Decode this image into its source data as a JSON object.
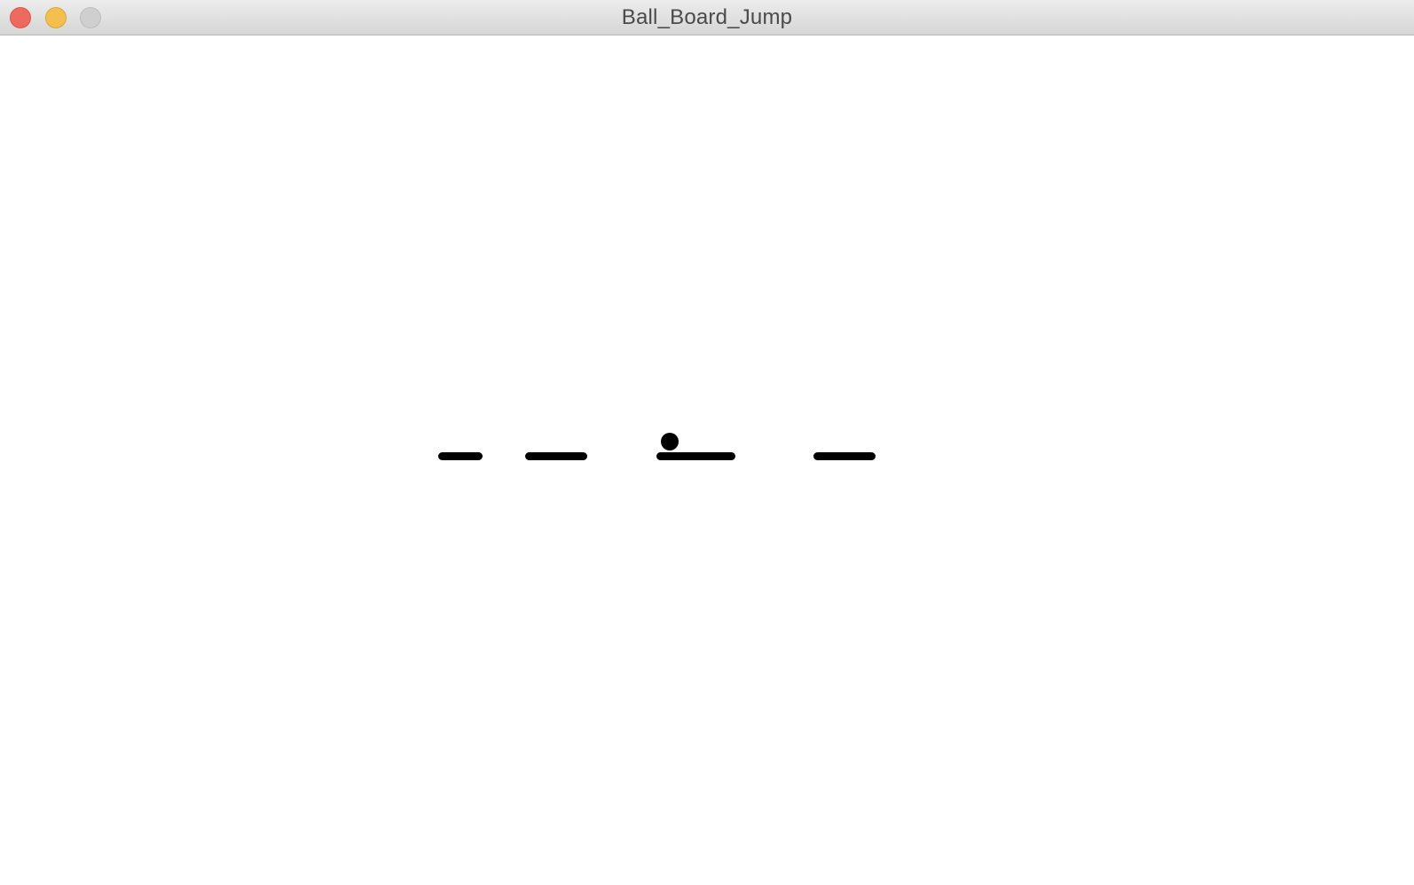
{
  "window": {
    "title": "Ball_Board_Jump",
    "background": "#ffffff",
    "buttons": [
      {
        "name": "close-button",
        "color": "#ee6a5f",
        "border": "#d9554b"
      },
      {
        "name": "minimize-button",
        "color": "#f5bf4f",
        "border": "#dca43b"
      },
      {
        "name": "zoom-button",
        "color": "#cfcfcf",
        "border": "#bdbdbd"
      }
    ]
  },
  "game": {
    "board_color": "#000000",
    "ball_color": "#000000",
    "board_count": 4
  }
}
